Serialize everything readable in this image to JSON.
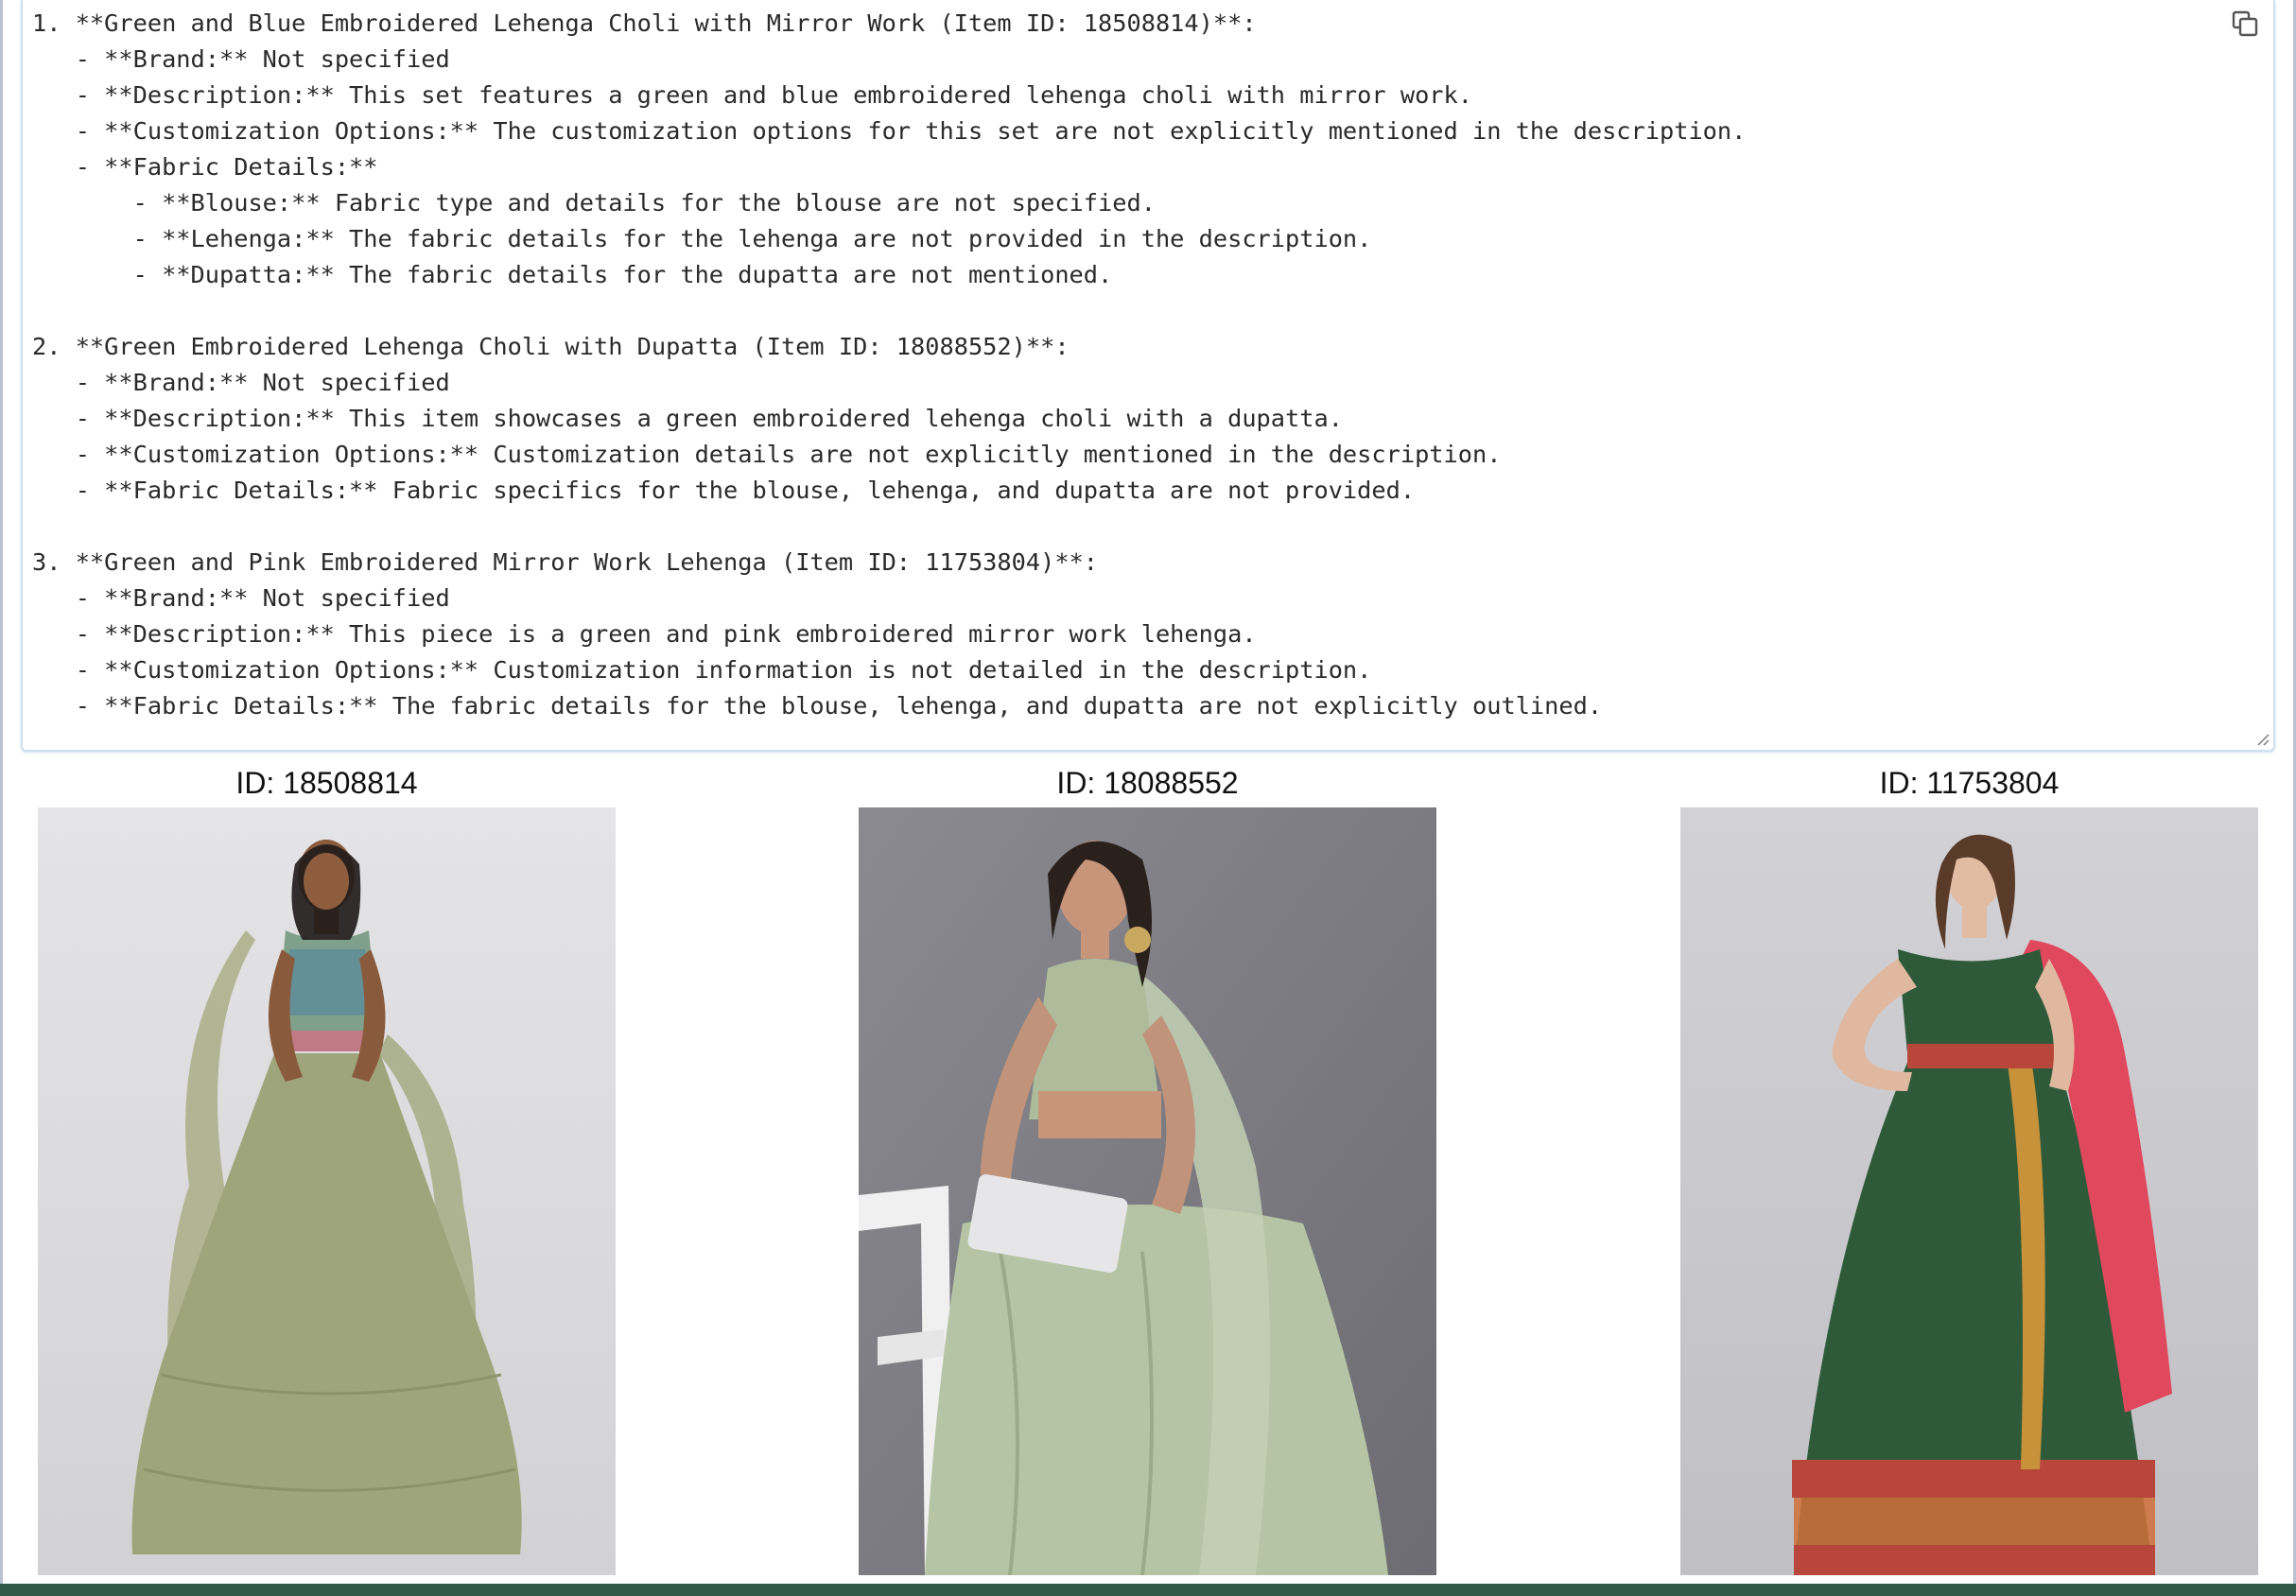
{
  "output": {
    "text": "1. **Green and Blue Embroidered Lehenga Choli with Mirror Work (Item ID: 18508814)**:\n   - **Brand:** Not specified\n   - **Description:** This set features a green and blue embroidered lehenga choli with mirror work.\n   - **Customization Options:** The customization options for this set are not explicitly mentioned in the description.\n   - **Fabric Details:**\n       - **Blouse:** Fabric type and details for the blouse are not specified.\n       - **Lehenga:** The fabric details for the lehenga are not provided in the description.\n       - **Dupatta:** The fabric details for the dupatta are not mentioned.\n\n2. **Green Embroidered Lehenga Choli with Dupatta (Item ID: 18088552)**:\n   - **Brand:** Not specified\n   - **Description:** This item showcases a green embroidered lehenga choli with a dupatta.\n   - **Customization Options:** Customization details are not explicitly mentioned in the description.\n   - **Fabric Details:** Fabric specifics for the blouse, lehenga, and dupatta are not provided.\n\n3. **Green and Pink Embroidered Mirror Work Lehenga (Item ID: 11753804)**:\n   - **Brand:** Not specified\n   - **Description:** This piece is a green and pink embroidered mirror work lehenga.\n   - **Customization Options:** Customization information is not detailed in the description.\n   - **Fabric Details:** The fabric details for the blouse, lehenga, and dupatta are not explicitly outlined.",
    "copy_icon": "copy-icon",
    "resize_icon": "resize-grip-icon"
  },
  "gallery": [
    {
      "title": "ID: 18508814",
      "image": "photo of model in sage green lehenga with embroidered blouse",
      "background": "#dcdcdc",
      "outfit_color": "#9ea57a"
    },
    {
      "title": "ID: 18088552",
      "image": "photo of model in mint green embroidered lehenga seated on white chair",
      "background": "#7a7a80",
      "outfit_color": "#b5c4a4"
    },
    {
      "title": "ID: 11753804",
      "image": "photo of model in dark green lehenga with red dupatta",
      "background": "#c9c9cd",
      "outfit_color": "#2f5a3a",
      "dupatta_color": "#e0485e"
    }
  ],
  "colors": {
    "border_accent": "#cfe0ef",
    "bottom_bar": "#2f5a4a"
  }
}
